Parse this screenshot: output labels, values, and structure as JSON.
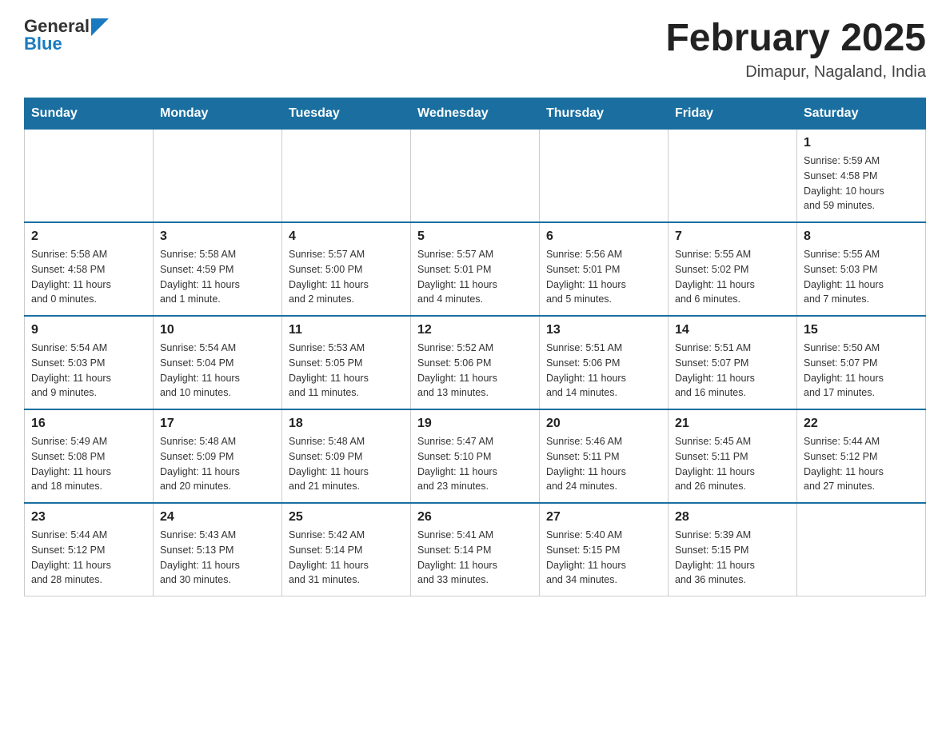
{
  "header": {
    "logo_general": "General",
    "logo_blue": "Blue",
    "month_title": "February 2025",
    "location": "Dimapur, Nagaland, India"
  },
  "days_of_week": [
    "Sunday",
    "Monday",
    "Tuesday",
    "Wednesday",
    "Thursday",
    "Friday",
    "Saturday"
  ],
  "weeks": [
    [
      {
        "day": "",
        "info": ""
      },
      {
        "day": "",
        "info": ""
      },
      {
        "day": "",
        "info": ""
      },
      {
        "day": "",
        "info": ""
      },
      {
        "day": "",
        "info": ""
      },
      {
        "day": "",
        "info": ""
      },
      {
        "day": "1",
        "info": "Sunrise: 5:59 AM\nSunset: 4:58 PM\nDaylight: 10 hours\nand 59 minutes."
      }
    ],
    [
      {
        "day": "2",
        "info": "Sunrise: 5:58 AM\nSunset: 4:58 PM\nDaylight: 11 hours\nand 0 minutes."
      },
      {
        "day": "3",
        "info": "Sunrise: 5:58 AM\nSunset: 4:59 PM\nDaylight: 11 hours\nand 1 minute."
      },
      {
        "day": "4",
        "info": "Sunrise: 5:57 AM\nSunset: 5:00 PM\nDaylight: 11 hours\nand 2 minutes."
      },
      {
        "day": "5",
        "info": "Sunrise: 5:57 AM\nSunset: 5:01 PM\nDaylight: 11 hours\nand 4 minutes."
      },
      {
        "day": "6",
        "info": "Sunrise: 5:56 AM\nSunset: 5:01 PM\nDaylight: 11 hours\nand 5 minutes."
      },
      {
        "day": "7",
        "info": "Sunrise: 5:55 AM\nSunset: 5:02 PM\nDaylight: 11 hours\nand 6 minutes."
      },
      {
        "day": "8",
        "info": "Sunrise: 5:55 AM\nSunset: 5:03 PM\nDaylight: 11 hours\nand 7 minutes."
      }
    ],
    [
      {
        "day": "9",
        "info": "Sunrise: 5:54 AM\nSunset: 5:03 PM\nDaylight: 11 hours\nand 9 minutes."
      },
      {
        "day": "10",
        "info": "Sunrise: 5:54 AM\nSunset: 5:04 PM\nDaylight: 11 hours\nand 10 minutes."
      },
      {
        "day": "11",
        "info": "Sunrise: 5:53 AM\nSunset: 5:05 PM\nDaylight: 11 hours\nand 11 minutes."
      },
      {
        "day": "12",
        "info": "Sunrise: 5:52 AM\nSunset: 5:06 PM\nDaylight: 11 hours\nand 13 minutes."
      },
      {
        "day": "13",
        "info": "Sunrise: 5:51 AM\nSunset: 5:06 PM\nDaylight: 11 hours\nand 14 minutes."
      },
      {
        "day": "14",
        "info": "Sunrise: 5:51 AM\nSunset: 5:07 PM\nDaylight: 11 hours\nand 16 minutes."
      },
      {
        "day": "15",
        "info": "Sunrise: 5:50 AM\nSunset: 5:07 PM\nDaylight: 11 hours\nand 17 minutes."
      }
    ],
    [
      {
        "day": "16",
        "info": "Sunrise: 5:49 AM\nSunset: 5:08 PM\nDaylight: 11 hours\nand 18 minutes."
      },
      {
        "day": "17",
        "info": "Sunrise: 5:48 AM\nSunset: 5:09 PM\nDaylight: 11 hours\nand 20 minutes."
      },
      {
        "day": "18",
        "info": "Sunrise: 5:48 AM\nSunset: 5:09 PM\nDaylight: 11 hours\nand 21 minutes."
      },
      {
        "day": "19",
        "info": "Sunrise: 5:47 AM\nSunset: 5:10 PM\nDaylight: 11 hours\nand 23 minutes."
      },
      {
        "day": "20",
        "info": "Sunrise: 5:46 AM\nSunset: 5:11 PM\nDaylight: 11 hours\nand 24 minutes."
      },
      {
        "day": "21",
        "info": "Sunrise: 5:45 AM\nSunset: 5:11 PM\nDaylight: 11 hours\nand 26 minutes."
      },
      {
        "day": "22",
        "info": "Sunrise: 5:44 AM\nSunset: 5:12 PM\nDaylight: 11 hours\nand 27 minutes."
      }
    ],
    [
      {
        "day": "23",
        "info": "Sunrise: 5:44 AM\nSunset: 5:12 PM\nDaylight: 11 hours\nand 28 minutes."
      },
      {
        "day": "24",
        "info": "Sunrise: 5:43 AM\nSunset: 5:13 PM\nDaylight: 11 hours\nand 30 minutes."
      },
      {
        "day": "25",
        "info": "Sunrise: 5:42 AM\nSunset: 5:14 PM\nDaylight: 11 hours\nand 31 minutes."
      },
      {
        "day": "26",
        "info": "Sunrise: 5:41 AM\nSunset: 5:14 PM\nDaylight: 11 hours\nand 33 minutes."
      },
      {
        "day": "27",
        "info": "Sunrise: 5:40 AM\nSunset: 5:15 PM\nDaylight: 11 hours\nand 34 minutes."
      },
      {
        "day": "28",
        "info": "Sunrise: 5:39 AM\nSunset: 5:15 PM\nDaylight: 11 hours\nand 36 minutes."
      },
      {
        "day": "",
        "info": ""
      }
    ]
  ]
}
